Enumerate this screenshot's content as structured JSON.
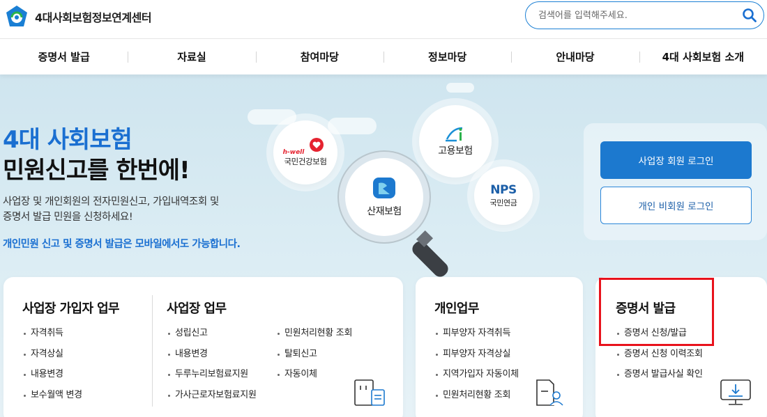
{
  "header": {
    "logo_text": "4대사회보험정보연계센터",
    "search_placeholder": "검색어를 입력해주세요."
  },
  "nav": {
    "items": [
      "증명서 발급",
      "자료실",
      "참여마당",
      "정보마당",
      "안내마당",
      "4대 사회보험 소개"
    ]
  },
  "hero": {
    "title_line1": "4대 사회보험",
    "title_line2": "민원신고를 한번에!",
    "desc_line1": "사업장 및 개인회원의 전자민원신고, 가입내역조회 및",
    "desc_line2": "증명서 발급 민원을 신청하세요!",
    "note": "개인민원 신고 및 증명서 발급은 모바일에서도 가능합니다."
  },
  "badges": {
    "health": {
      "brand": "h-well",
      "label": "국민건강보험"
    },
    "employment": {
      "label": "고용보험"
    },
    "industrial": {
      "label": "산재보험"
    },
    "pension": {
      "brand": "NPS",
      "label": "국민연금"
    }
  },
  "login": {
    "business_login": "사업장 회원 로그인",
    "personal_login": "개인 비회원 로그인"
  },
  "cards": {
    "subscriber": {
      "title": "사업장 가입자 업무",
      "items": [
        "자격취득",
        "자격상실",
        "내용변경",
        "보수월액 변경"
      ]
    },
    "business": {
      "title": "사업장 업무",
      "col1": [
        "성립신고",
        "내용변경",
        "두루누리보험료지원",
        "가사근로자보험료지원"
      ],
      "col2": [
        "민원처리현황 조회",
        "탈퇴신고",
        "자동이체"
      ]
    },
    "personal": {
      "title": "개인업무",
      "items": [
        "피부양자 자격취득",
        "피부양자 자격상실",
        "지역가입자 자동이체",
        "민원처리현황 조회"
      ]
    },
    "certificate": {
      "title": "증명서 발급",
      "items": [
        "증명서 신청/발급",
        "증명서 신청 이력조회",
        "증명서 발급사실 확인"
      ]
    }
  },
  "colors": {
    "brand_blue": "#1c79cf",
    "highlight_red": "#e8121c",
    "hero_bg": "#d6e9f1"
  }
}
